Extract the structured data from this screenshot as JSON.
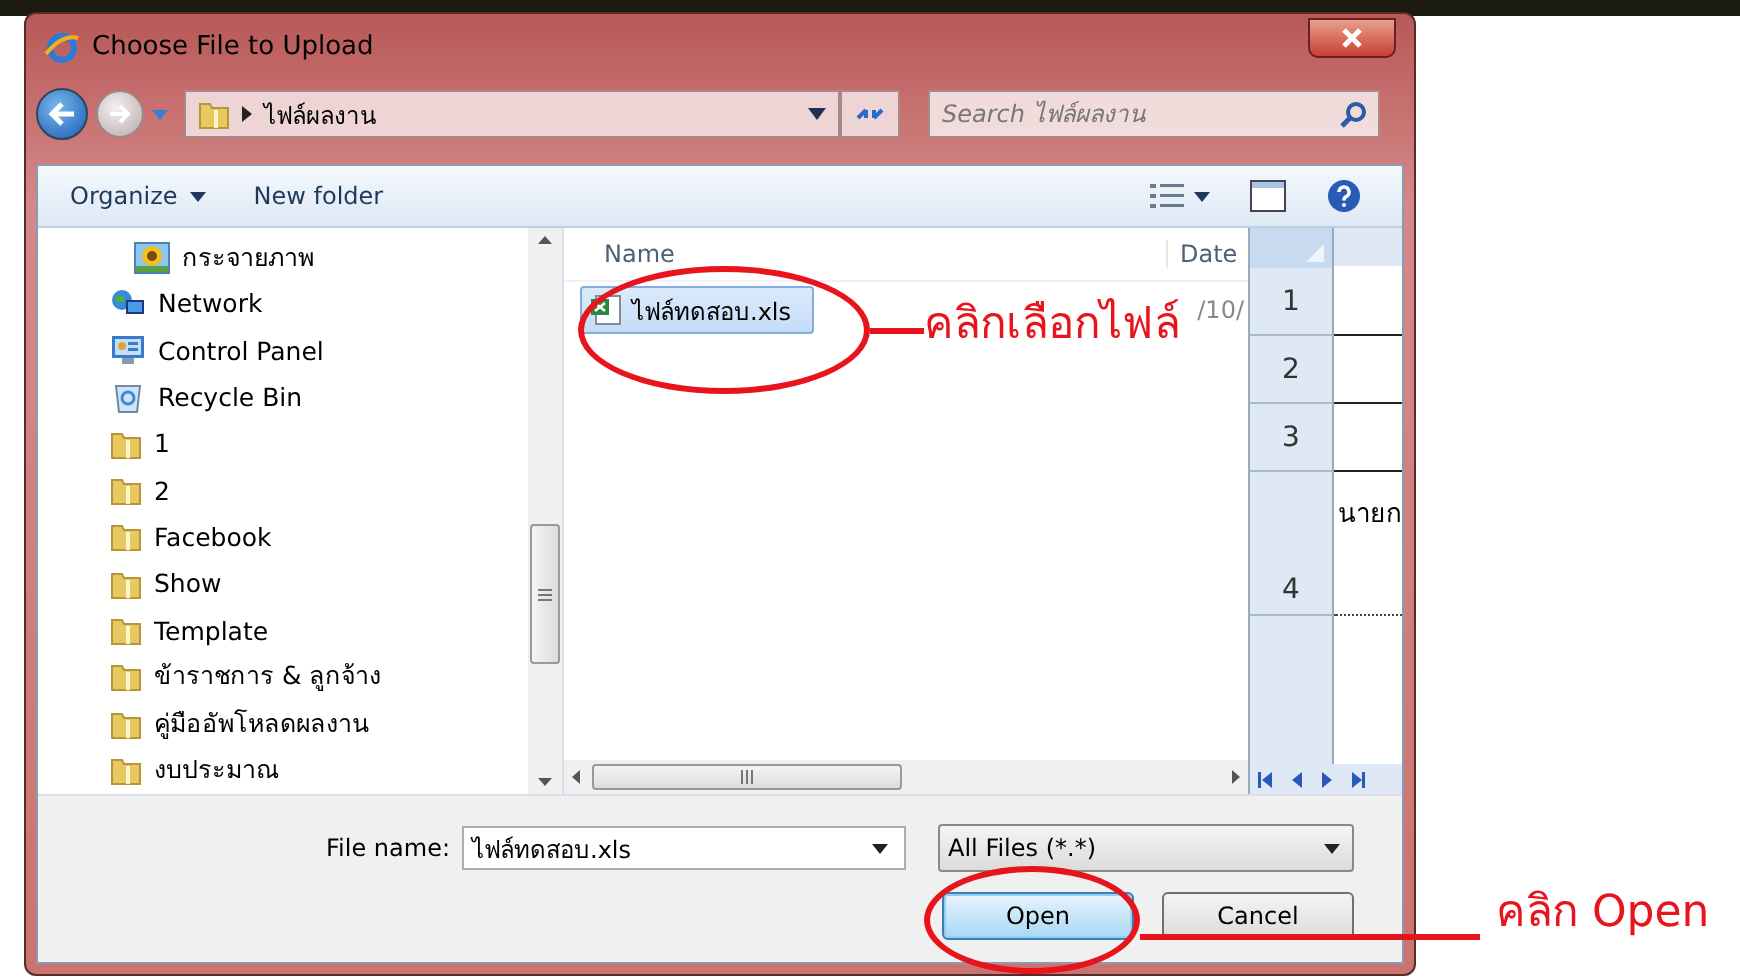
{
  "window": {
    "title": "Choose File to Upload"
  },
  "address": {
    "path": "ไฟล์ผลงาน",
    "search_placeholder": "Search ไฟล์ผลงาน"
  },
  "toolbar": {
    "organize": "Organize",
    "new_folder": "New folder"
  },
  "nav_items": [
    {
      "label": "กระจายภาพ",
      "kind": "pictures"
    },
    {
      "label": "Network",
      "kind": "network"
    },
    {
      "label": "Control Panel",
      "kind": "control"
    },
    {
      "label": "Recycle Bin",
      "kind": "bin"
    },
    {
      "label": "1",
      "kind": "folder"
    },
    {
      "label": "2",
      "kind": "folder"
    },
    {
      "label": "Facebook",
      "kind": "folder"
    },
    {
      "label": "Show",
      "kind": "folder"
    },
    {
      "label": "Template",
      "kind": "folder"
    },
    {
      "label": "ข้าราชการ & ลูกจ้าง",
      "kind": "folder"
    },
    {
      "label": "คู่มืออัพโหลดผลงาน",
      "kind": "folder"
    },
    {
      "label": "งบประมาณ",
      "kind": "folder"
    }
  ],
  "columns": [
    "Name",
    "Date"
  ],
  "files": [
    {
      "name": "ไฟล์ทดสอบ.xls",
      "date": "/10/",
      "selected": true
    }
  ],
  "sheet": {
    "rows": [
      "1",
      "2",
      "3",
      "4"
    ],
    "cell": "นายก"
  },
  "file_name": {
    "label": "File name:",
    "value": "ไฟล์ทดสอบ.xls"
  },
  "file_type": "All Files (*.*)",
  "buttons": [
    {
      "label": "Open",
      "kind": "default"
    },
    {
      "label": "Cancel",
      "kind": "normal"
    }
  ],
  "annotations": [
    {
      "text": "คลิกเลือกไฟล์"
    },
    {
      "text": "คลิก Open"
    }
  ]
}
